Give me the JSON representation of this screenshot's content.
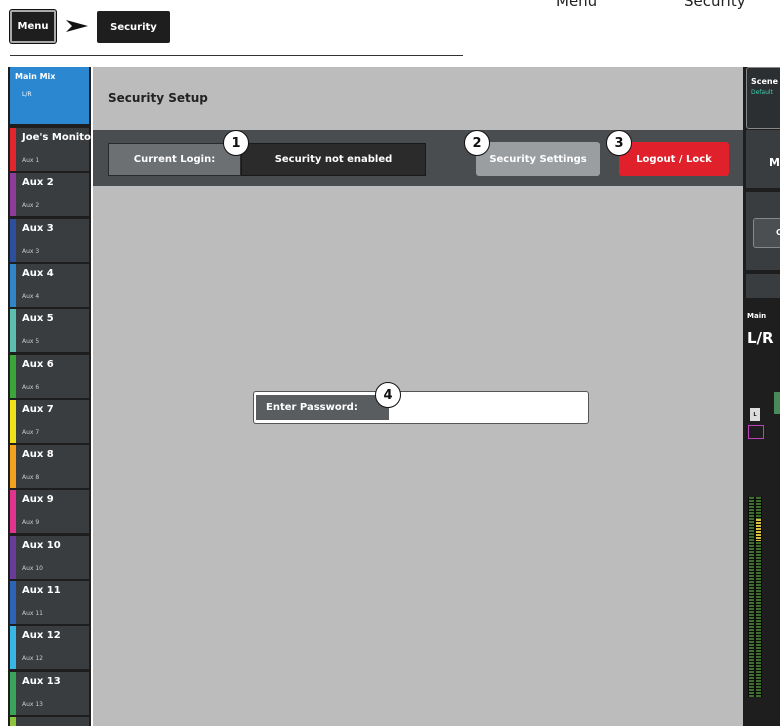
{
  "breadcrumb": {
    "menu_label": "Menu",
    "current_label": "Security",
    "top_labels": [
      "Menu",
      "Security"
    ]
  },
  "sidebar": {
    "main_mix": {
      "name": "Main Mix",
      "sub": "L/R"
    },
    "items": [
      {
        "name": "Joe's Monitor",
        "sub": "Aux 1",
        "color": "#e3262e"
      },
      {
        "name": "Aux 2",
        "sub": "Aux 2",
        "color": "#8e3c9a"
      },
      {
        "name": "Aux 3",
        "sub": "Aux 3",
        "color": "#2c4f9e"
      },
      {
        "name": "Aux 4",
        "sub": "Aux 4",
        "color": "#2f86c8"
      },
      {
        "name": "Aux 5",
        "sub": "Aux 5",
        "color": "#5cc0b0"
      },
      {
        "name": "Aux 6",
        "sub": "Aux 6",
        "color": "#3aa53a"
      },
      {
        "name": "Aux 7",
        "sub": "Aux 7",
        "color": "#f0e21a"
      },
      {
        "name": "Aux 8",
        "sub": "Aux 8",
        "color": "#f4a21e"
      },
      {
        "name": "Aux 9",
        "sub": "Aux 9",
        "color": "#e0348e"
      },
      {
        "name": "Aux 10",
        "sub": "Aux 10",
        "color": "#6a3c9a"
      },
      {
        "name": "Aux 11",
        "sub": "Aux 11",
        "color": "#2e64b8"
      },
      {
        "name": "Aux 12",
        "sub": "Aux 12",
        "color": "#3ab6e6"
      },
      {
        "name": "Aux 13",
        "sub": "Aux 13",
        "color": "#3aa55a"
      },
      {
        "name": "",
        "sub": "",
        "color": "#8cc43c"
      }
    ]
  },
  "main": {
    "title": "Security Setup",
    "current_login_label": "Current Login:",
    "current_login_value": "Security not enabled",
    "security_settings_button": "Security Settings",
    "logout_button": "Logout / Lock",
    "password_label": "Enter Password:",
    "password_value": ""
  },
  "callouts": [
    "1",
    "2",
    "3",
    "4"
  ],
  "right_panel": {
    "scene_label": "Scene",
    "scene_value": "Default",
    "m_label": "M",
    "c_label": "C",
    "main_label": "Main",
    "lr_label": "L/R",
    "l_label": "L"
  },
  "colors": {
    "accent_blue": "#2a87d0",
    "logout_red": "#e0202a",
    "panel_grey": "#bcbcbc"
  },
  "icons": {
    "breadcrumb_separator": "arrow-right-icon"
  }
}
